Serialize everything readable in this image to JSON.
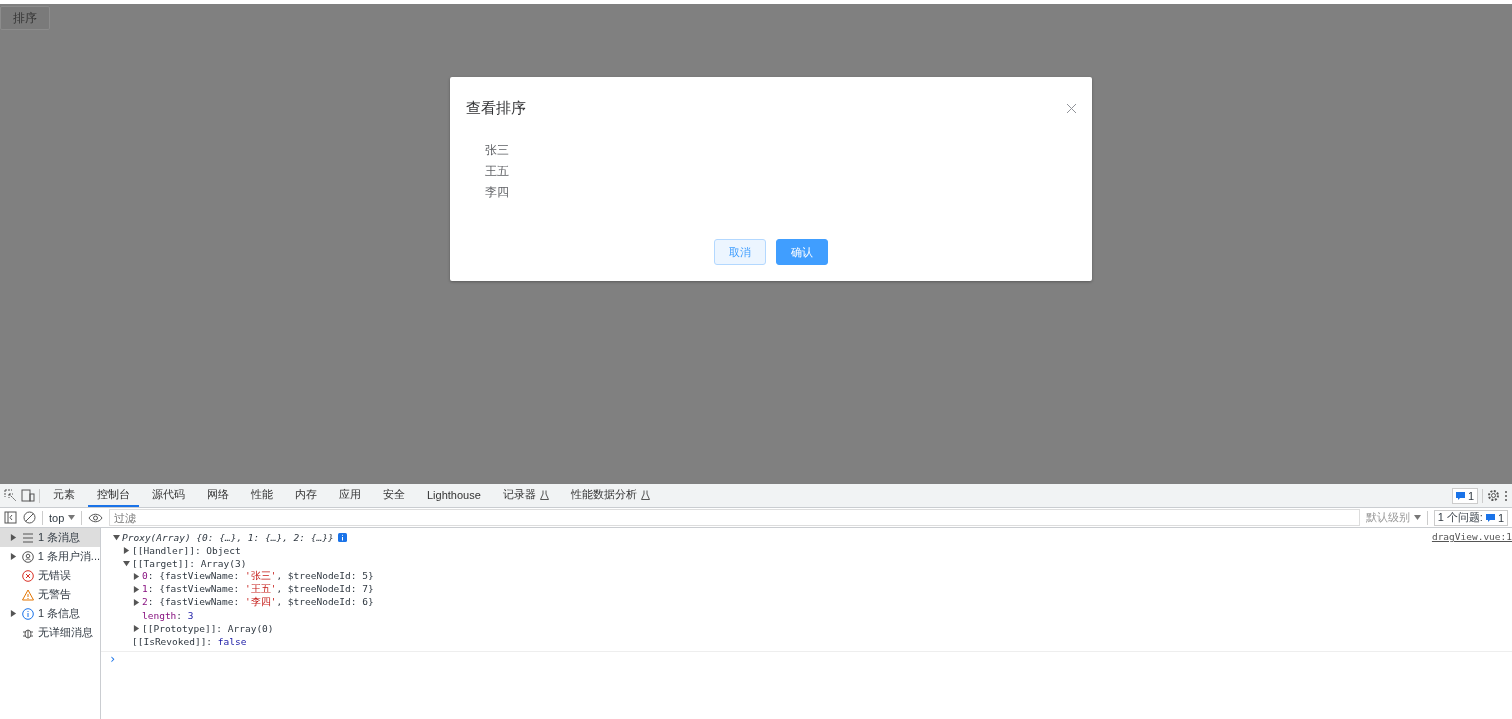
{
  "page": {
    "sort_button": "排序"
  },
  "dialog": {
    "title": "查看排序",
    "items": [
      "张三",
      "王五",
      "李四"
    ],
    "cancel": "取消",
    "confirm": "确认"
  },
  "devtools": {
    "tabs": [
      {
        "label": "元素",
        "selected": false
      },
      {
        "label": "控制台",
        "selected": true
      },
      {
        "label": "源代码",
        "selected": false
      },
      {
        "label": "网络",
        "selected": false
      },
      {
        "label": "性能",
        "selected": false
      },
      {
        "label": "内存",
        "selected": false
      },
      {
        "label": "应用",
        "selected": false
      },
      {
        "label": "安全",
        "selected": false
      },
      {
        "label": "Lighthouse",
        "selected": false
      },
      {
        "label": "记录器",
        "selected": false,
        "experimental": true
      },
      {
        "label": "性能数据分析",
        "selected": false,
        "experimental": true
      }
    ],
    "issues_badge": "1",
    "context": "top",
    "filter_placeholder": "过滤",
    "level_select": "默认级别",
    "issues_label": "1 个问题:",
    "issues_count": "1",
    "sidebar": [
      {
        "label": "1 条消息",
        "kind": "list",
        "expanded": false,
        "selected": true
      },
      {
        "label": "1 条用户消...",
        "kind": "user",
        "expanded": false,
        "selected": false
      },
      {
        "label": "无错误",
        "kind": "error",
        "selected": false
      },
      {
        "label": "无警告",
        "kind": "warning",
        "selected": false
      },
      {
        "label": "1 条信息",
        "kind": "info",
        "expanded": false,
        "selected": false
      },
      {
        "label": "无详细消息",
        "kind": "bug",
        "selected": false
      }
    ],
    "source_link": "dragView.vue:1",
    "console": [
      {
        "parts": [
          {
            "kind": "italic",
            "text": "Proxy(Array) {0: {…}, 1: {…}, 2: {…}}"
          }
        ],
        "expanded": true,
        "info": true,
        "children": [
          {
            "parts": [
              {
                "kind": "plain",
                "text": "[[Handler]]: Object"
              }
            ],
            "expanded": false
          },
          {
            "parts": [
              {
                "kind": "plain",
                "text": "[[Target]]: Array(3)"
              }
            ],
            "expanded": true,
            "children": [
              {
                "parts": [
                  {
                    "kind": "key",
                    "text": "0"
                  },
                  {
                    "kind": "plain",
                    "text": ": {fastViewName: "
                  },
                  {
                    "kind": "string",
                    "text": "'张三'"
                  },
                  {
                    "kind": "plain",
                    "text": ", $treeNodeId: 5}"
                  }
                ],
                "expanded": false
              },
              {
                "parts": [
                  {
                    "kind": "key",
                    "text": "1"
                  },
                  {
                    "kind": "plain",
                    "text": ": {fastViewName: "
                  },
                  {
                    "kind": "string",
                    "text": "'王五'"
                  },
                  {
                    "kind": "plain",
                    "text": ", $treeNodeId: 7}"
                  }
                ],
                "expanded": false
              },
              {
                "parts": [
                  {
                    "kind": "key",
                    "text": "2"
                  },
                  {
                    "kind": "plain",
                    "text": ": {fastViewName: "
                  },
                  {
                    "kind": "string",
                    "text": "'李四'"
                  },
                  {
                    "kind": "plain",
                    "text": ", $treeNodeId: 6}"
                  }
                ],
                "expanded": false
              },
              {
                "parts": [
                  {
                    "kind": "key",
                    "text": "length"
                  },
                  {
                    "kind": "plain",
                    "text": ": "
                  },
                  {
                    "kind": "number",
                    "text": "3"
                  }
                ]
              },
              {
                "parts": [
                  {
                    "kind": "plain",
                    "text": "[[Prototype]]: Array(0)"
                  }
                ],
                "expanded": false
              }
            ]
          },
          {
            "parts": [
              {
                "kind": "plain",
                "text": "[[IsRevoked]]: "
              },
              {
                "kind": "number",
                "text": "false"
              }
            ]
          }
        ]
      }
    ],
    "prompt": "›"
  }
}
